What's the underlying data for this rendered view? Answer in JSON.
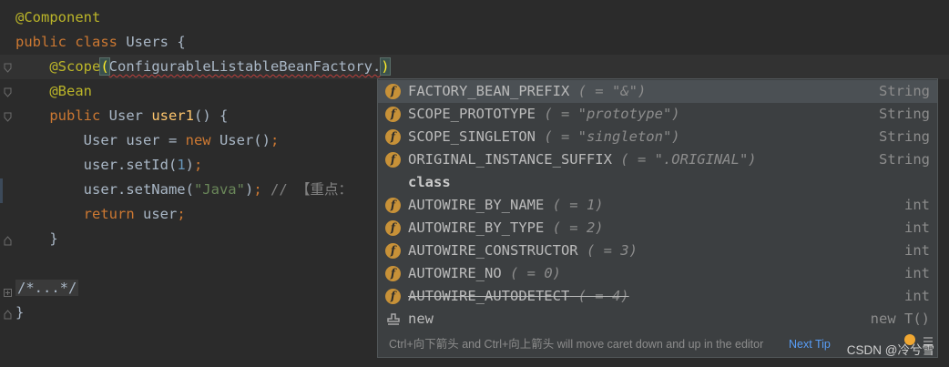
{
  "editor": {
    "lines": [
      {
        "parts": [
          {
            "t": "@Component",
            "c": "ann"
          }
        ]
      },
      {
        "parts": [
          {
            "t": "public ",
            "c": "kw"
          },
          {
            "t": "class ",
            "c": "kw"
          },
          {
            "t": "Users {",
            "c": "id"
          }
        ]
      },
      {
        "parts": [
          {
            "t": "    ",
            "c": "id"
          },
          {
            "t": "@Scope",
            "c": "ann"
          },
          {
            "t": "(",
            "c": "paren-hl"
          },
          {
            "t": "ConfigurableListableBeanFactory.",
            "c": "id squig"
          },
          {
            "t": "CARET",
            "c": "caret"
          },
          {
            "t": ")",
            "c": "paren-hl"
          }
        ]
      },
      {
        "parts": [
          {
            "t": "    ",
            "c": "id"
          },
          {
            "t": "@Bean",
            "c": "ann"
          }
        ]
      },
      {
        "parts": [
          {
            "t": "    ",
            "c": "id"
          },
          {
            "t": "public ",
            "c": "kw"
          },
          {
            "t": "User ",
            "c": "id"
          },
          {
            "t": "user1",
            "c": "fn"
          },
          {
            "t": "() {",
            "c": "id"
          }
        ]
      },
      {
        "parts": [
          {
            "t": "        User user = ",
            "c": "id"
          },
          {
            "t": "new ",
            "c": "kw"
          },
          {
            "t": "User()",
            "c": "id"
          },
          {
            "t": ";",
            "c": "kw"
          }
        ]
      },
      {
        "parts": [
          {
            "t": "        user.setId(",
            "c": "id"
          },
          {
            "t": "1",
            "c": "num"
          },
          {
            "t": ")",
            "c": "id"
          },
          {
            "t": ";",
            "c": "kw"
          }
        ]
      },
      {
        "parts": [
          {
            "t": "        user.setName(",
            "c": "id"
          },
          {
            "t": "\"Java\"",
            "c": "str"
          },
          {
            "t": ")",
            "c": "id"
          },
          {
            "t": "; ",
            "c": "kw"
          },
          {
            "t": "// 【重点：",
            "c": "cmt"
          }
        ]
      },
      {
        "parts": [
          {
            "t": "        ",
            "c": "id"
          },
          {
            "t": "return ",
            "c": "kw"
          },
          {
            "t": "user",
            "c": "id"
          },
          {
            "t": ";",
            "c": "kw"
          }
        ]
      },
      {
        "parts": [
          {
            "t": "    }",
            "c": "id"
          }
        ]
      },
      {
        "parts": [
          {
            "t": "",
            "c": "id"
          }
        ]
      },
      {
        "parts": [
          {
            "t": "/*...*/",
            "c": "fold-block"
          }
        ]
      },
      {
        "parts": [
          {
            "t": "}",
            "c": "id"
          }
        ]
      }
    ]
  },
  "completion": {
    "items": [
      {
        "name": "FACTORY_BEAN_PREFIX",
        "val": " ( = \"&\")",
        "type": "String",
        "icon": "field-icon",
        "selected": true
      },
      {
        "name": "SCOPE_PROTOTYPE",
        "val": " ( = \"prototype\")",
        "type": "String",
        "icon": "field-icon"
      },
      {
        "name": "SCOPE_SINGLETON",
        "val": " ( = \"singleton\")",
        "type": "String",
        "icon": "field-icon"
      },
      {
        "name": "ORIGINAL_INSTANCE_SUFFIX",
        "val": " ( = \".ORIGINAL\")",
        "type": "String",
        "icon": "field-icon"
      },
      {
        "name": "class",
        "val": "",
        "type": "",
        "icon": "none",
        "bold": true
      },
      {
        "name": "AUTOWIRE_BY_NAME",
        "val": " ( = 1)",
        "type": "int",
        "icon": "field-icon"
      },
      {
        "name": "AUTOWIRE_BY_TYPE",
        "val": " ( = 2)",
        "type": "int",
        "icon": "field-icon"
      },
      {
        "name": "AUTOWIRE_CONSTRUCTOR",
        "val": " ( = 3)",
        "type": "int",
        "icon": "field-icon"
      },
      {
        "name": "AUTOWIRE_NO",
        "val": " ( = 0)",
        "type": "int",
        "icon": "field-icon"
      },
      {
        "name": "AUTOWIRE_AUTODETECT",
        "val": " ( = 4)",
        "type": "int",
        "icon": "field-icon",
        "strike": true
      },
      {
        "name": "new",
        "val": "",
        "type": "new T()",
        "icon": "stamp-icon"
      }
    ],
    "field_glyph": "f",
    "footer_hint": "Ctrl+向下箭头 and Ctrl+向上箭头 will move caret down and up in the editor",
    "next_tip": "Next Tip"
  },
  "watermark": "CSDN @冷兮雪",
  "colors": {
    "accent": "#c79138",
    "selection": "#4b5054",
    "link": "#589df6"
  }
}
